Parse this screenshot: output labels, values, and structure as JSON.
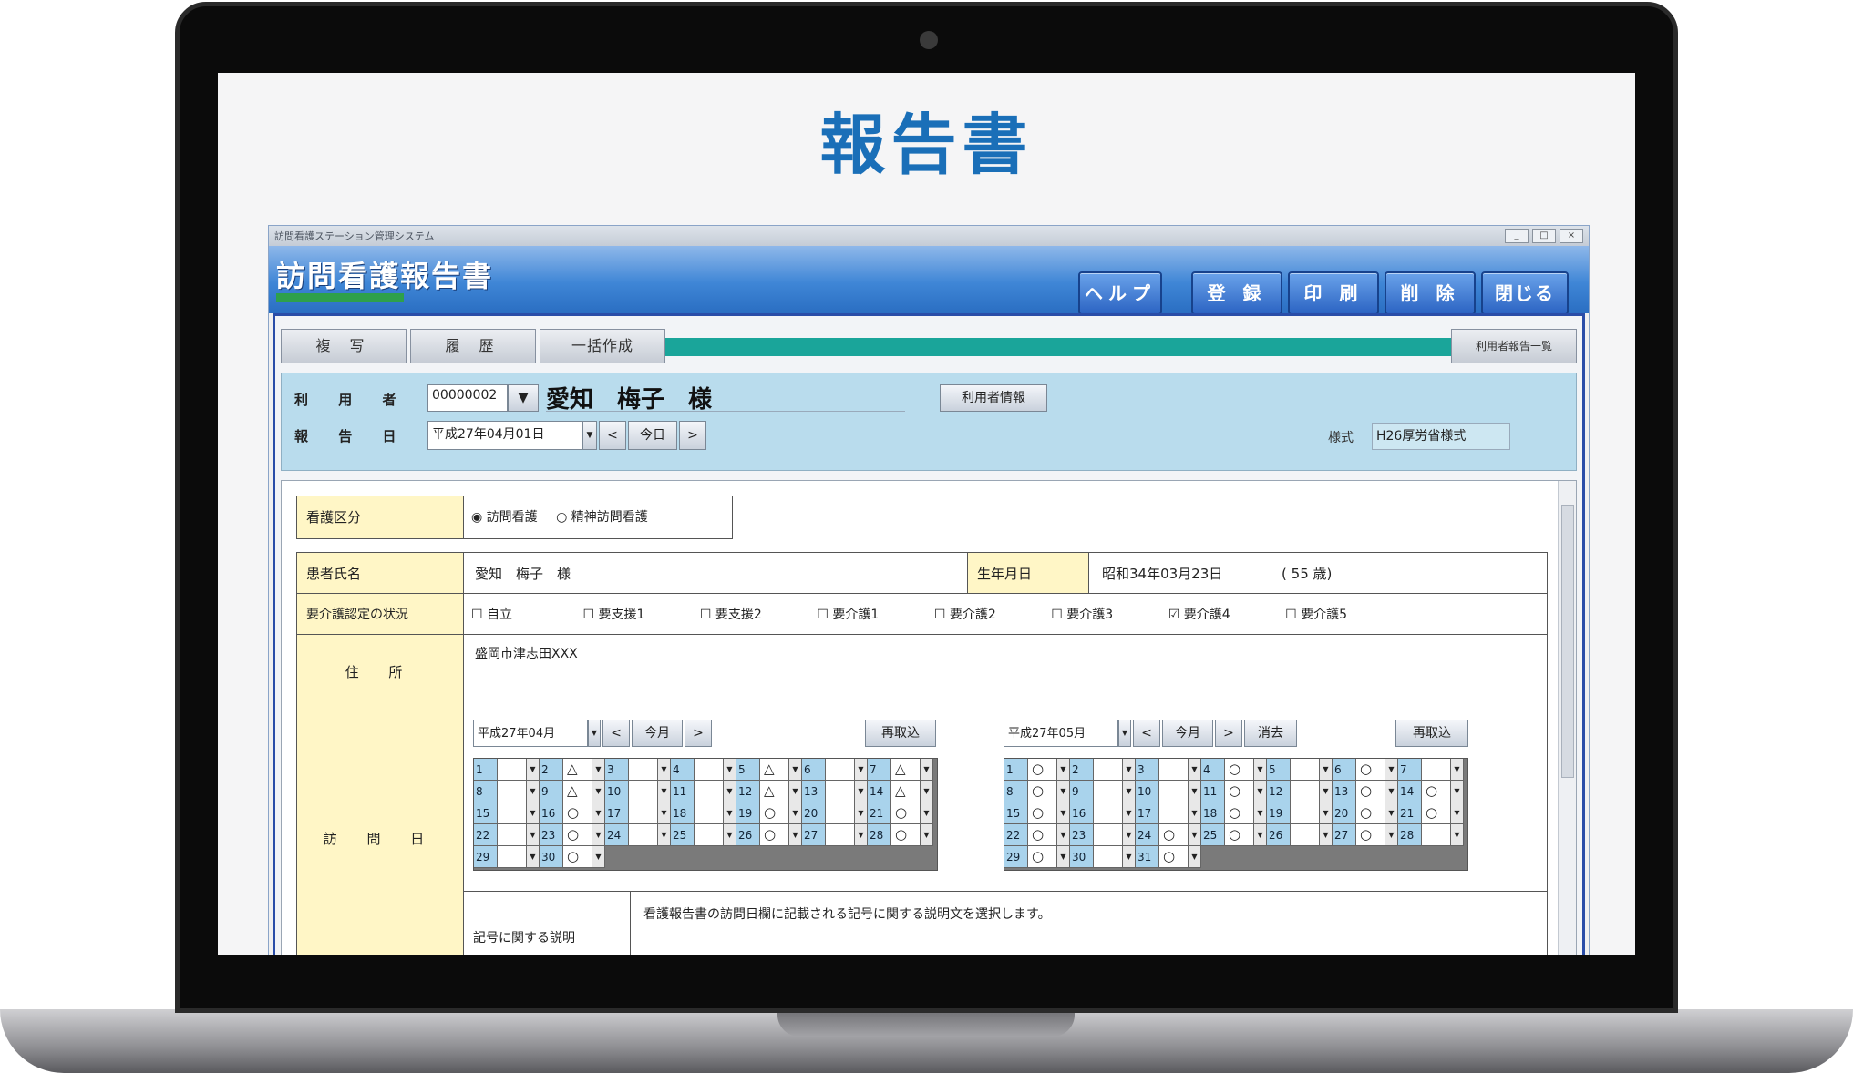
{
  "hero": {
    "title": "報告書"
  },
  "window": {
    "caption": "訪問看護ステーション管理システム",
    "header_title": "訪問看護報告書",
    "buttons": {
      "help": "ヘルプ",
      "register": "登 録",
      "print": "印 刷",
      "delete": "削 除",
      "close": "閉じる"
    }
  },
  "tabs": {
    "copy": "複 写",
    "history": "履 歴",
    "bulk": "一括作成",
    "list": "利用者報告一覧"
  },
  "user": {
    "label_user": "利 用 者",
    "label_date": "報 告 日",
    "id": "00000002",
    "name": "愛知　梅子　様",
    "info_button": "利用者情報",
    "report_date": "平成27年04月01日",
    "prev": "<",
    "today": "今日",
    "next": ">",
    "format_label": "様式",
    "format_value": "H26厚労省様式"
  },
  "form": {
    "care_type_label": "看護区分",
    "care_type_options": [
      "訪問看護",
      "精神訪問看護"
    ],
    "patient_label": "患者氏名",
    "patient_name": "愛知　梅子　様",
    "dob_label": "生年月日",
    "dob_value": "昭和34年03月23日",
    "age_value": "( 55 歳)",
    "care_level_label": "要介護認定の状況",
    "care_levels": [
      "自立",
      "要支援1",
      "要支援2",
      "要介護1",
      "要介護2",
      "要介護3",
      "要介護4",
      "要介護5"
    ],
    "care_level_checked": "要介護4",
    "address_label": "住 所",
    "address_value": "盛岡市津志田XXX",
    "visit_label": "訪 問 日",
    "symbol_label": "記号に関する説明",
    "symbol_text": "看護報告書の訪問日欄に記載される記号に関する説明文を選択します。"
  },
  "calendar_left": {
    "month": "平成27年04月",
    "prev": "<",
    "this_month": "今月",
    "next": ">",
    "reload": "再取込",
    "rows": [
      [
        [
          "1",
          ""
        ],
        [
          "2",
          "△"
        ],
        [
          "3",
          ""
        ],
        [
          "4",
          ""
        ],
        [
          "5",
          "△"
        ],
        [
          "6",
          ""
        ],
        [
          "7",
          "△"
        ]
      ],
      [
        [
          "8",
          ""
        ],
        [
          "9",
          "△"
        ],
        [
          "10",
          ""
        ],
        [
          "11",
          ""
        ],
        [
          "12",
          "△"
        ],
        [
          "13",
          ""
        ],
        [
          "14",
          "△"
        ]
      ],
      [
        [
          "15",
          ""
        ],
        [
          "16",
          "○"
        ],
        [
          "17",
          ""
        ],
        [
          "18",
          ""
        ],
        [
          "19",
          "○"
        ],
        [
          "20",
          ""
        ],
        [
          "21",
          "○"
        ]
      ],
      [
        [
          "22",
          ""
        ],
        [
          "23",
          "○"
        ],
        [
          "24",
          ""
        ],
        [
          "25",
          ""
        ],
        [
          "26",
          "○"
        ],
        [
          "27",
          ""
        ],
        [
          "28",
          "○"
        ]
      ],
      [
        [
          "29",
          ""
        ],
        [
          "30",
          "○"
        ]
      ]
    ]
  },
  "calendar_right": {
    "month": "平成27年05月",
    "prev": "<",
    "this_month": "今月",
    "next": ">",
    "clear": "消去",
    "reload": "再取込",
    "rows": [
      [
        [
          "1",
          "○"
        ],
        [
          "2",
          ""
        ],
        [
          "3",
          ""
        ],
        [
          "4",
          "○"
        ],
        [
          "5",
          ""
        ],
        [
          "6",
          "○"
        ],
        [
          "7",
          ""
        ]
      ],
      [
        [
          "8",
          "○"
        ],
        [
          "9",
          ""
        ],
        [
          "10",
          ""
        ],
        [
          "11",
          "○"
        ],
        [
          "12",
          ""
        ],
        [
          "13",
          "○"
        ],
        [
          "14",
          "○"
        ]
      ],
      [
        [
          "15",
          "○"
        ],
        [
          "16",
          ""
        ],
        [
          "17",
          ""
        ],
        [
          "18",
          "○"
        ],
        [
          "19",
          ""
        ],
        [
          "20",
          "○"
        ],
        [
          "21",
          "○"
        ]
      ],
      [
        [
          "22",
          "○"
        ],
        [
          "23",
          ""
        ],
        [
          "24",
          "○"
        ],
        [
          "25",
          "○"
        ],
        [
          "26",
          ""
        ],
        [
          "27",
          "○"
        ],
        [
          "28",
          ""
        ]
      ],
      [
        [
          "29",
          "○"
        ],
        [
          "30",
          ""
        ],
        [
          "31",
          "○"
        ]
      ]
    ]
  }
}
